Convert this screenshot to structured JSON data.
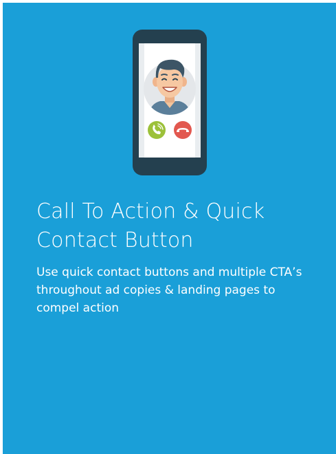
{
  "card": {
    "title": "Call To Action & Quick Contact Button",
    "description": "Use quick contact buttons and multiple CTA’s throughout ad copies & landing pages to compel action"
  },
  "colors": {
    "background": "#1a9fd8",
    "phone_body": "#24404f",
    "phone_screen": "#ffffff",
    "accept_button": "#9cc13a",
    "decline_button": "#e2584f",
    "avatar_circle": "#e4e7ea",
    "text": "#ffffff"
  },
  "icons": {
    "illustration": "phone-call-illustration",
    "accept": "accept-call-icon",
    "decline": "decline-call-icon",
    "avatar": "caller-avatar-icon"
  }
}
